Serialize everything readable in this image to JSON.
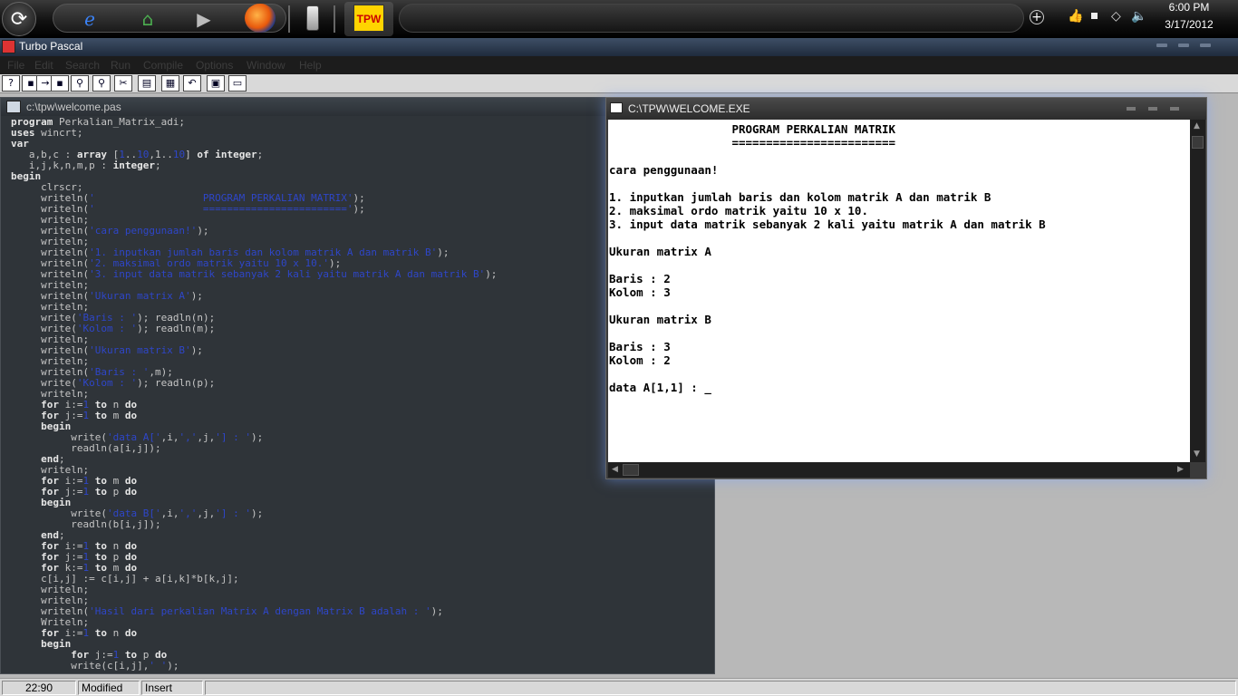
{
  "taskbar": {
    "time": "6:00 PM",
    "date": "3/17/2012",
    "tpw_label": "TPW"
  },
  "window": {
    "title": "Turbo Pascal"
  },
  "menu": [
    "File",
    "Edit",
    "Search",
    "Run",
    "Compile",
    "Options",
    "Window",
    "Help"
  ],
  "editor": {
    "filename": "c:\\tpw\\welcome.pas",
    "code": [
      "program Perkalian_Matrix_adi;",
      "uses wincrt;",
      "var",
      "   a,b,c : array [1..10,1..10] of integer;",
      "   i,j,k,n,m,p : integer;",
      "begin",
      "     clrscr;",
      "     writeln('                  PROGRAM PERKALIAN MATRIX');",
      "     writeln('                  ========================');",
      "     writeln;",
      "     writeln('cara penggunaan!');",
      "     writeln;",
      "     writeln('1. inputkan jumlah baris dan kolom matrik A dan matrik B');",
      "     writeln('2. maksimal ordo matrik yaitu 10 x 10.');",
      "     writeln('3. input data matrik sebanyak 2 kali yaitu matrik A dan matrik B');",
      "     writeln;",
      "     writeln('Ukuran matrix A');",
      "     writeln;",
      "     write('Baris : '); readln(n);",
      "     write('Kolom : '); readln(m);",
      "     writeln;",
      "     writeln('Ukuran matrix B');",
      "     writeln;",
      "     writeln('Baris : ',m);",
      "     write('Kolom : '); readln(p);",
      "     writeln;",
      "     for i:=1 to n do",
      "     for j:=1 to m do",
      "     begin",
      "          write('data A[',i,',',j,'] : ');",
      "          readln(a[i,j]);",
      "     end;",
      "     writeln;",
      "     for i:=1 to m do",
      "     for j:=1 to p do",
      "     begin",
      "          write('data B[',i,',',j,'] : ');",
      "          readln(b[i,j]);",
      "     end;",
      "     for i:=1 to n do",
      "     for j:=1 to p do",
      "     for k:=1 to m do",
      "     c[i,j] := c[i,j] + a[i,k]*b[k,j];",
      "     writeln;",
      "     writeln;",
      "     writeln('Hasil dari perkalian Matrix A dengan Matrix B adalah : ');",
      "     Writeln;",
      "     for i:=1 to n do",
      "     begin",
      "          for j:=1 to p do",
      "          write(c[i,j],' ');"
    ]
  },
  "console": {
    "title": "C:\\TPW\\WELCOME.EXE",
    "output": [
      "                  PROGRAM PERKALIAN MATRIK",
      "                  ========================",
      "",
      "cara penggunaan!",
      "",
      "1. inputkan jumlah baris dan kolom matrik A dan matrik B",
      "2. maksimal ordo matrik yaitu 10 x 10.",
      "3. input data matrik sebanyak 2 kali yaitu matrik A dan matrik B",
      "",
      "Ukuran matrix A",
      "",
      "Baris : 2",
      "Kolom : 3",
      "",
      "Ukuran matrix B",
      "",
      "Baris : 3",
      "Kolom : 2",
      "",
      "data A[1,1] : _"
    ]
  },
  "status": {
    "position": "22:90",
    "modified": "Modified",
    "mode": "Insert"
  },
  "colors": {
    "keyword": "#e6e6e6",
    "string": "#2e46c8",
    "code_text": "#c5c5c5",
    "editor_bg": "#2f3439"
  }
}
